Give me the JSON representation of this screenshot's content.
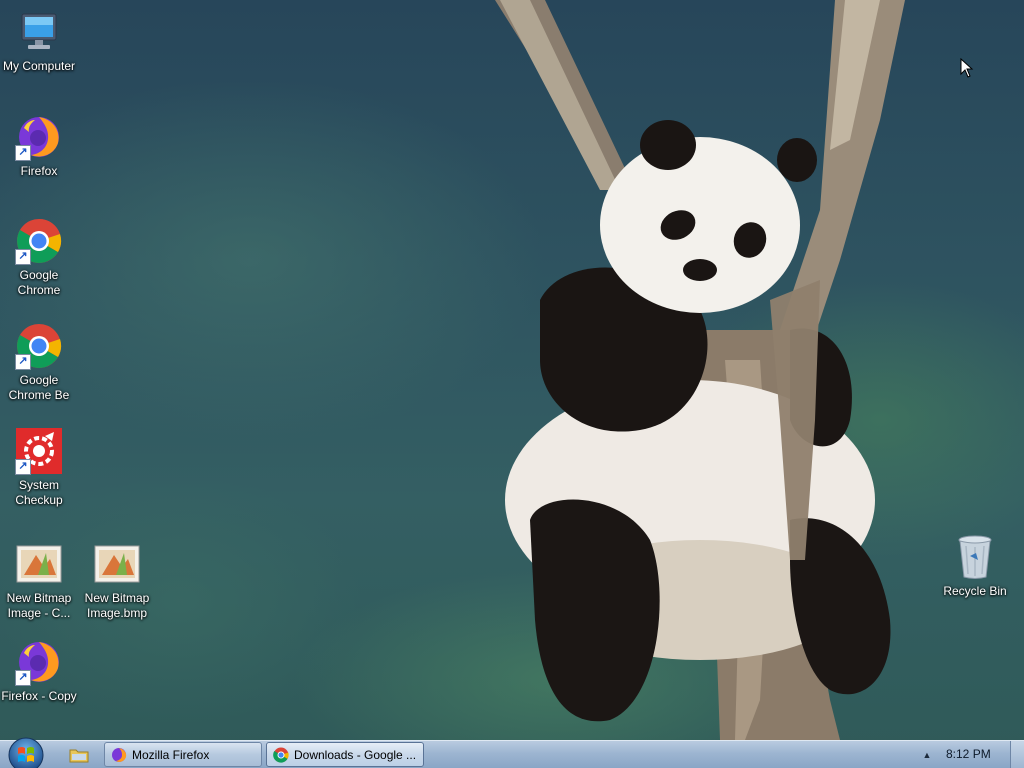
{
  "desktop": {
    "icons": [
      {
        "name": "my-computer-icon",
        "label": "My Computer"
      },
      {
        "name": "firefox-icon",
        "label": "Firefox"
      },
      {
        "name": "google-chrome-icon",
        "label": "Google Chrome"
      },
      {
        "name": "google-chrome-beta-icon",
        "label": "Google Chrome Be"
      },
      {
        "name": "system-checkup-icon",
        "label": "System Checkup"
      },
      {
        "name": "new-bitmap-copy-icon",
        "label": "New Bitmap Image - C..."
      },
      {
        "name": "new-bitmap-icon",
        "label": "New Bitmap Image.bmp"
      },
      {
        "name": "firefox-copy-icon",
        "label": "Firefox - Copy"
      },
      {
        "name": "recycle-bin-icon",
        "label": "Recycle Bin"
      }
    ]
  },
  "taskbar": {
    "start_icon": "windows-orb-icon",
    "quick_launch_icon": "folder-icon",
    "tasks": [
      {
        "icon": "firefox-icon",
        "label": "Mozilla Firefox"
      },
      {
        "icon": "chrome-icon",
        "label": "Downloads - Google ..."
      }
    ],
    "tray_arrow": "▲",
    "clock": "8:12 PM"
  },
  "colors": {
    "taskbar": "#9db5d1",
    "wallpaper": "#2e5360"
  }
}
